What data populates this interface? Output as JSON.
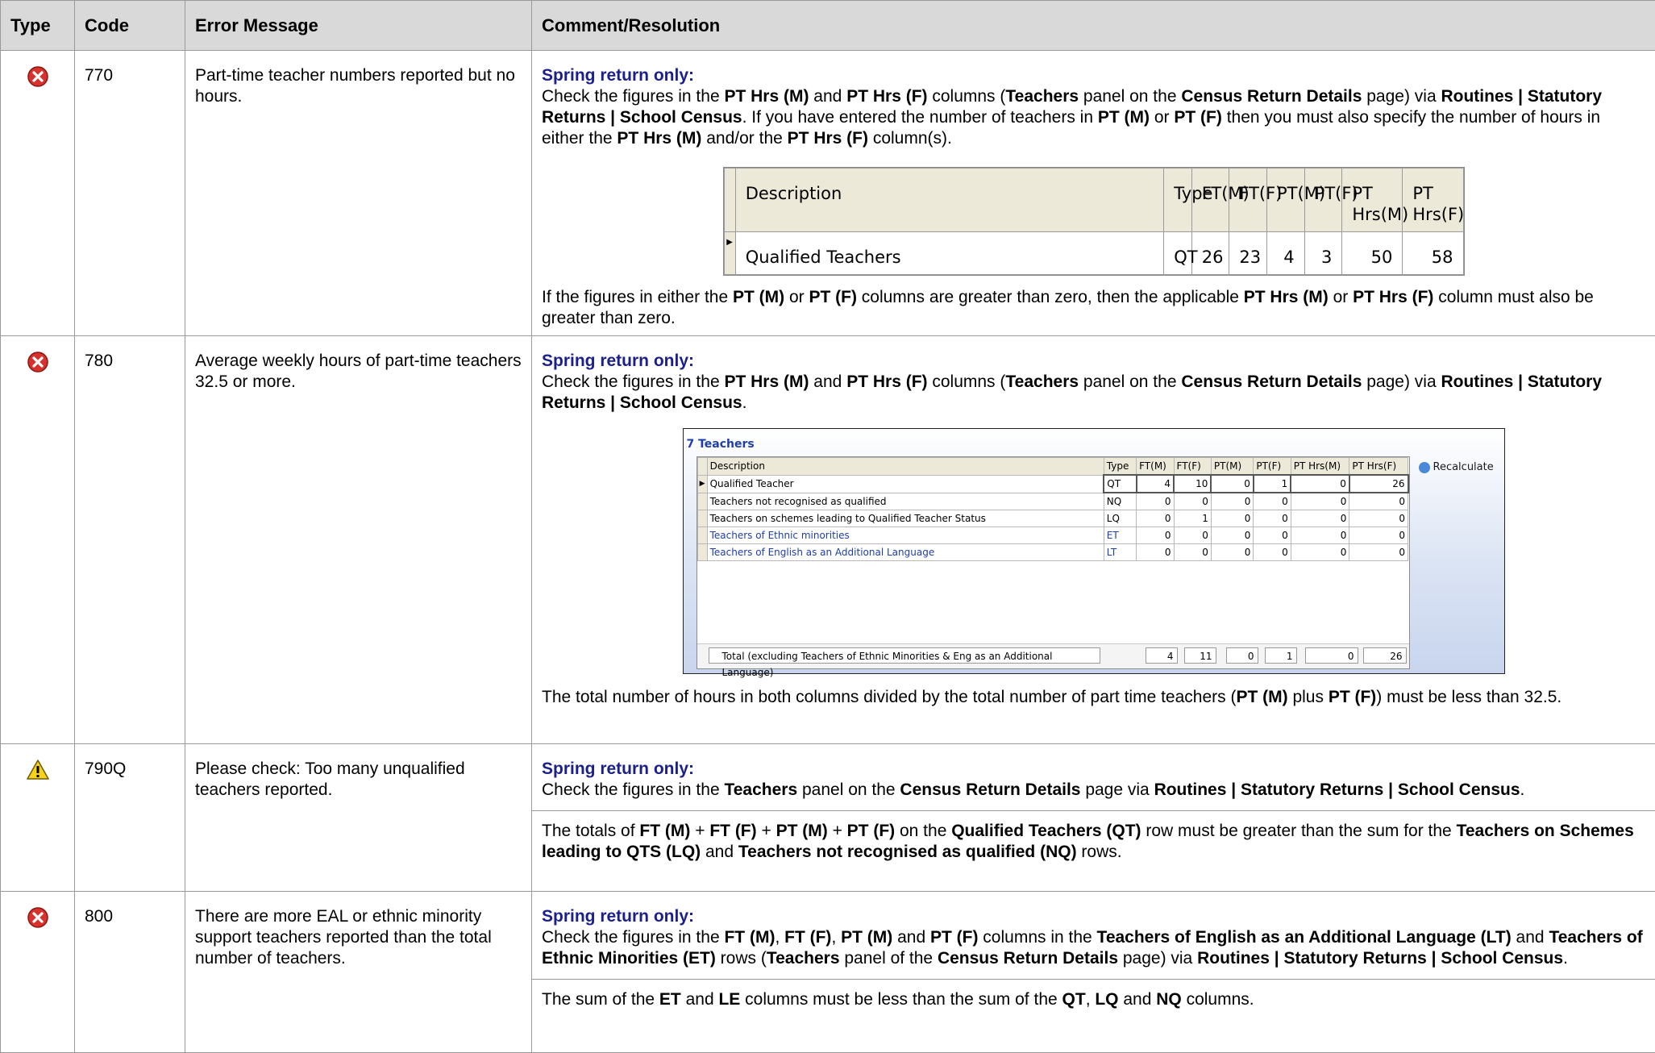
{
  "header": {
    "type": "Type",
    "code": "Code",
    "error_message": "Error Message",
    "comment": "Comment/Resolution"
  },
  "rows": [
    {
      "type_icon": "error-icon",
      "code": "770",
      "message": "Part-time teacher numbers reported but no hours.",
      "spring": "Spring return only:",
      "p1_a": "Check the figures in the ",
      "p1_b": "PT Hrs (M)",
      "p1_c": " and ",
      "p1_d": "PT Hrs (F)",
      "p1_e": " columns (",
      "p1_f": "Teachers",
      "p1_g": " panel on the ",
      "p1_h": "Census Return Details",
      "p1_i": " page) via ",
      "p1_j": "Routines | Statutory Returns | School Census",
      "p1_k": ". If you have entered the number of teachers in ",
      "p1_l": "PT (M)",
      "p1_m": " or ",
      "p1_n": "PT (F)",
      "p1_o": " then you must also specify the number of hours in either the ",
      "p1_p": "PT Hrs (M)",
      "p1_q": " and/or the ",
      "p1_r": "PT Hrs (F)",
      "p1_s": " column(s).",
      "p2_a": "If the figures in either the ",
      "p2_b": "PT (M)",
      "p2_c": " or ",
      "p2_d": "PT (F)",
      "p2_e": " columns are greater than zero, then the applicable ",
      "p2_f": "PT Hrs (M)",
      "p2_g": " or ",
      "p2_h": "PT Hrs (F)",
      "p2_i": " column must also be greater than zero."
    },
    {
      "type_icon": "error-icon",
      "code": "780",
      "message": "Average weekly hours of part-time teachers 32.5 or more.",
      "spring": "Spring return only:",
      "p1_a": "Check the figures in the ",
      "p1_b": "PT Hrs (M)",
      "p1_c": " and ",
      "p1_d": "PT Hrs (F)",
      "p1_e": " columns (",
      "p1_f": "Teachers",
      "p1_g": " panel on the ",
      "p1_h": "Census Return Details",
      "p1_i": " page) via ",
      "p1_j": "Routines | Statutory Returns | School Census",
      "p1_k": ".",
      "p2_a": "The total number of hours in both columns divided by the total number of part time teachers (",
      "p2_b": "PT (M)",
      "p2_c": " plus ",
      "p2_d": "PT (F)",
      "p2_e": ") must be less than 32.5."
    },
    {
      "type_icon": "warning-icon",
      "code": "790Q",
      "message": "Please check: Too many unqualified teachers reported.",
      "spring": "Spring return only:",
      "p1_a": "Check the figures in the ",
      "p1_b": "Teachers",
      "p1_c": " panel on the ",
      "p1_d": "Census Return Details",
      "p1_e": " page via ",
      "p1_f": "Routines | Statutory Returns | School Census",
      "p1_g": ".",
      "p2_a": "The totals of ",
      "p2_b": "FT (M)",
      "p2_c": " + ",
      "p2_d": "FT (F)",
      "p2_e": " + ",
      "p2_f": "PT (M)",
      "p2_g": " + ",
      "p2_h": "PT (F)",
      "p2_i": " on the ",
      "p2_j": "Qualified Teachers (QT)",
      "p2_k": " row must be greater than the sum for the ",
      "p2_l": "Teachers on Schemes leading to QTS (LQ)",
      "p2_m": " and ",
      "p2_n": "Teachers not recognised as qualified (NQ)",
      "p2_o": " rows."
    },
    {
      "type_icon": "error-icon",
      "code": "800",
      "message": "There are more EAL or ethnic minority support teachers reported than the total number of teachers.",
      "spring": "Spring return only:",
      "p1_a": "Check the figures in the ",
      "p1_b": "FT (M)",
      "p1_c": ", ",
      "p1_d": "FT (F)",
      "p1_e": ", ",
      "p1_f": "PT (M)",
      "p1_g": " and ",
      "p1_h": "PT (F)",
      "p1_i": " columns in the ",
      "p1_j": "Teachers of English as an Additional Language (LT)",
      "p1_k": " and ",
      "p1_l": "Teachers of Ethnic Minorities (ET)",
      "p1_m": " rows (",
      "p1_n": "Teachers",
      "p1_o": " panel of the ",
      "p1_p": "Census Return Details",
      "p1_q": " page) via ",
      "p1_r": "Routines | Statutory Returns | School Census",
      "p1_s": ".",
      "p2_a": "The sum of the ",
      "p2_b": "ET",
      "p2_c": " and ",
      "p2_d": "LE",
      "p2_e": " columns must be less than the sum of the ",
      "p2_f": "QT",
      "p2_g": ", ",
      "p2_h": "LQ",
      "p2_i": " and ",
      "p2_j": "NQ",
      "p2_k": " columns."
    }
  ],
  "small_grid": {
    "headers": [
      "Description",
      "Type",
      "FT(M)",
      "FT(F)",
      "PT(M)",
      "PT(F)",
      "PT Hrs(M)",
      "PT Hrs(F)"
    ],
    "row": [
      "Qualified Teachers",
      "QT",
      "26",
      "23",
      "4",
      "3",
      "50",
      "58"
    ]
  },
  "teachers_panel": {
    "title": "7 Teachers",
    "recalculate": "Recalculate",
    "headers": [
      "Description",
      "Type",
      "FT(M)",
      "FT(F)",
      "PT(M)",
      "PT(F)",
      "PT Hrs(M)",
      "PT Hrs(F)"
    ],
    "rows": [
      [
        "Qualified Teacher",
        "QT",
        "4",
        "10",
        "0",
        "1",
        "0",
        "26"
      ],
      [
        "Teachers not recognised as qualified",
        "NQ",
        "0",
        "0",
        "0",
        "0",
        "0",
        "0"
      ],
      [
        "Teachers on schemes leading to Qualified Teacher Status",
        "LQ",
        "0",
        "1",
        "0",
        "0",
        "0",
        "0"
      ],
      [
        "Teachers of Ethnic minorities",
        "ET",
        "0",
        "0",
        "0",
        "0",
        "0",
        "0"
      ],
      [
        "Teachers of English as an Additional Language",
        "LT",
        "0",
        "0",
        "0",
        "0",
        "0",
        "0"
      ]
    ],
    "total_label": "Total (excluding Teachers of Ethnic Minorities & Eng as an Additional Language)",
    "totals": [
      "4",
      "11",
      "0",
      "1",
      "0",
      "26"
    ]
  }
}
